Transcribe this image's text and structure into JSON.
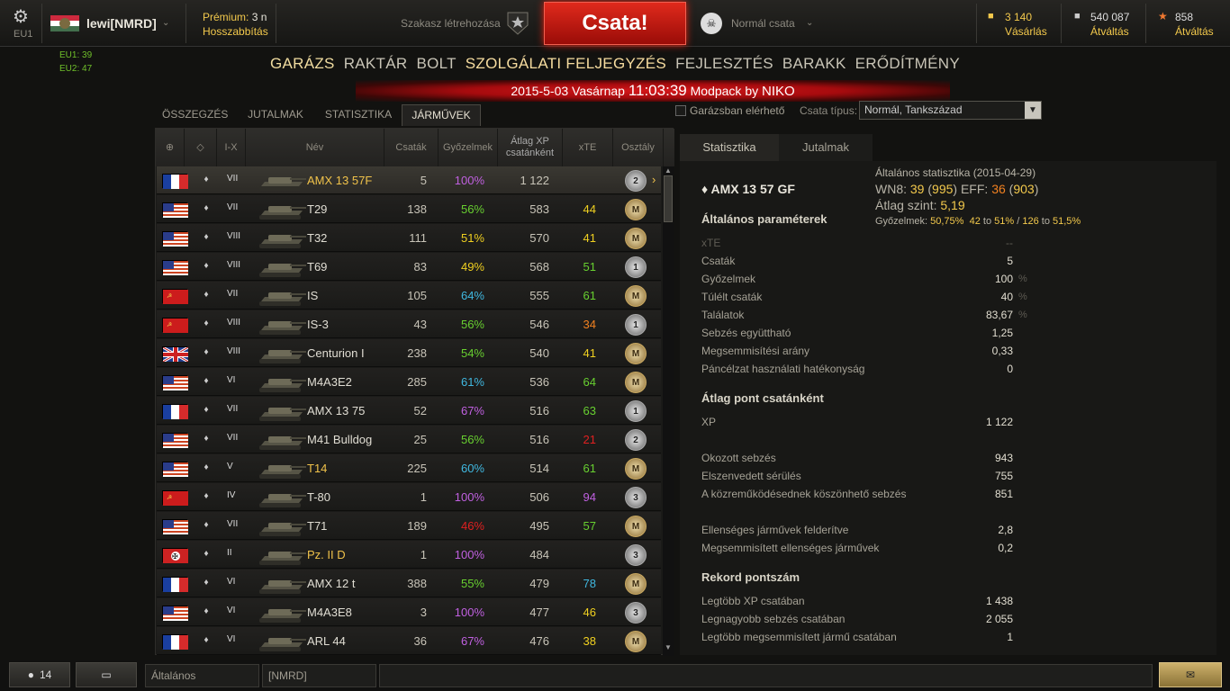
{
  "header": {
    "server": "EU1",
    "player": "lewi[NMRD]",
    "premium_label": "Prémium:",
    "premium_value": "3 n",
    "extend_label": "Hosszabbítás",
    "platoon_label": "Szakasz létrehozása",
    "battle_button": "Csata!",
    "mode_label": "Normál csata",
    "gold_value": "3 140",
    "gold_action": "Vásárlás",
    "credits_value": "540 087",
    "credits_action": "Átváltás",
    "xp_value": "858",
    "xp_action": "Átváltás",
    "online1": "EU1: 39",
    "online2": "EU2: 47"
  },
  "nav": [
    "GARÁZS",
    "RAKTÁR",
    "BOLT",
    "SZOLGÁLATI FELJEGYZÉS",
    "FEJLESZTÉS",
    "BARAKK",
    "ERŐDÍTMÉNY"
  ],
  "clock": {
    "date": "2015-5-03 Vasárnap",
    "time": "11:03:39",
    "mod": "Modpack by",
    "author": "NIKO"
  },
  "subtabs": [
    "ÖSSZEGZÉS",
    "JUTALMAK",
    "STATISZTIKA",
    "JÁRMŰVEK"
  ],
  "filter": {
    "garage_only": "Garázsban elérhető",
    "type_label": "Csata típus:",
    "type_value": "Normál, Tankszázad"
  },
  "columns": {
    "tier": "I-X",
    "name": "Név",
    "battles": "Csaták",
    "wins": "Győzelmek",
    "avgxp": "Átlag XP csatánként",
    "xte": "xTE",
    "class": "Osztály"
  },
  "rows": [
    {
      "flag": "fr",
      "tier": "VII",
      "name": "AMX 13 57F",
      "battles": "5",
      "wins": "100%",
      "wc": "#c060e0",
      "xp": "1 122",
      "xte": "",
      "xc": "#fff",
      "badge": "2",
      "gold": true,
      "sel": true
    },
    {
      "flag": "us",
      "tier": "VII",
      "name": "T29",
      "battles": "138",
      "wins": "56%",
      "wc": "#68d030",
      "xp": "583",
      "xte": "44",
      "xc": "#f0d020",
      "badge": "M"
    },
    {
      "flag": "us",
      "tier": "VIII",
      "name": "T32",
      "battles": "111",
      "wins": "51%",
      "wc": "#f0d020",
      "xp": "570",
      "xte": "41",
      "xc": "#f0d020",
      "badge": "M"
    },
    {
      "flag": "us",
      "tier": "VIII",
      "name": "T69",
      "battles": "83",
      "wins": "49%",
      "wc": "#f0d020",
      "xp": "568",
      "xte": "51",
      "xc": "#68d030",
      "badge": "1"
    },
    {
      "flag": "su",
      "tier": "VII",
      "name": "IS",
      "battles": "105",
      "wins": "64%",
      "wc": "#40b8e0",
      "xp": "555",
      "xte": "61",
      "xc": "#68d030",
      "badge": "M"
    },
    {
      "flag": "su",
      "tier": "VIII",
      "name": "IS-3",
      "battles": "43",
      "wins": "56%",
      "wc": "#68d030",
      "xp": "546",
      "xte": "34",
      "xc": "#f08020",
      "badge": "1"
    },
    {
      "flag": "uk",
      "tier": "VIII",
      "name": "Centurion I",
      "battles": "238",
      "wins": "54%",
      "wc": "#68d030",
      "xp": "540",
      "xte": "41",
      "xc": "#f0d020",
      "badge": "M"
    },
    {
      "flag": "us",
      "tier": "VI",
      "name": "M4A3E2",
      "battles": "285",
      "wins": "61%",
      "wc": "#40b8e0",
      "xp": "536",
      "xte": "64",
      "xc": "#68d030",
      "badge": "M"
    },
    {
      "flag": "fr",
      "tier": "VII",
      "name": "AMX 13 75",
      "battles": "52",
      "wins": "67%",
      "wc": "#c060e0",
      "xp": "516",
      "xte": "63",
      "xc": "#68d030",
      "badge": "1"
    },
    {
      "flag": "us",
      "tier": "VII",
      "name": "M41 Bulldog",
      "battles": "25",
      "wins": "56%",
      "wc": "#68d030",
      "xp": "516",
      "xte": "21",
      "xc": "#e02020",
      "badge": "2"
    },
    {
      "flag": "us",
      "tier": "V",
      "name": "T14",
      "battles": "225",
      "wins": "60%",
      "wc": "#40b8e0",
      "xp": "514",
      "xte": "61",
      "xc": "#68d030",
      "badge": "M",
      "gold": true
    },
    {
      "flag": "su",
      "tier": "IV",
      "name": "T-80",
      "battles": "1",
      "wins": "100%",
      "wc": "#c060e0",
      "xp": "506",
      "xte": "94",
      "xc": "#c060e0",
      "badge": "3"
    },
    {
      "flag": "us",
      "tier": "VII",
      "name": "T71",
      "battles": "189",
      "wins": "46%",
      "wc": "#e02020",
      "xp": "495",
      "xte": "57",
      "xc": "#68d030",
      "badge": "M"
    },
    {
      "flag": "de",
      "tier": "II",
      "name": "Pz. II D",
      "battles": "1",
      "wins": "100%",
      "wc": "#c060e0",
      "xp": "484",
      "xte": "",
      "xc": "#fff",
      "badge": "3",
      "gold": true
    },
    {
      "flag": "fr",
      "tier": "VI",
      "name": "AMX 12 t",
      "battles": "388",
      "wins": "55%",
      "wc": "#68d030",
      "xp": "479",
      "xte": "78",
      "xc": "#40b8e0",
      "badge": "M"
    },
    {
      "flag": "us",
      "tier": "VI",
      "name": "M4A3E8",
      "battles": "3",
      "wins": "100%",
      "wc": "#c060e0",
      "xp": "477",
      "xte": "46",
      "xc": "#f0d020",
      "badge": "3"
    },
    {
      "flag": "fr",
      "tier": "VI",
      "name": "ARL 44",
      "battles": "36",
      "wins": "67%",
      "wc": "#c060e0",
      "xp": "476",
      "xte": "38",
      "xc": "#f0d020",
      "badge": "M"
    }
  ],
  "panel": {
    "tabs": [
      "Statisztika",
      "Jutalmak"
    ],
    "vehicle": "AMX 13 57 GF",
    "gen_title": "Általános statisztika (2015-04-29)",
    "wn8_label": "WN8:",
    "wn8": "39",
    "wn8b": "995",
    "eff_label": "EFF:",
    "eff": "36",
    "effb": "903",
    "avg_label": "Átlag szint:",
    "avg": "5,19",
    "winrate_label": "Győzelmek:",
    "winrate": "50,75%",
    "wr_a": "42",
    "wr_to1": "to",
    "wr_b": "51%",
    "wr_c": "126",
    "wr_to2": "to",
    "wr_d": "51,5%",
    "sec1": "Általános paraméterek",
    "params": [
      [
        "xTE",
        "--",
        ""
      ],
      [
        "Csaták",
        "5",
        ""
      ],
      [
        "Győzelmek",
        "100",
        "%"
      ],
      [
        "Túlélt csaták",
        "40",
        "%"
      ],
      [
        "Találatok",
        "83,67",
        "%"
      ],
      [
        "Sebzés együttható",
        "1,25",
        ""
      ],
      [
        "Megsemmisítési arány",
        "0,33",
        ""
      ],
      [
        "Páncélzat használati hatékonyság",
        "0",
        ""
      ]
    ],
    "sec2": "Átlag pont csatánként",
    "avgs": [
      [
        "XP",
        "1 122"
      ],
      [
        "Okozott sebzés",
        "943"
      ],
      [
        "Elszenvedett sérülés",
        "755"
      ],
      [
        "A közreműködésednek köszönhető sebzés",
        "851"
      ],
      [
        "Ellenséges járművek felderítve",
        "2,8"
      ],
      [
        "Megsemmisített ellenséges járművek",
        "0,2"
      ]
    ],
    "sec3": "Rekord pontszám",
    "records": [
      [
        "Legtöbb XP csatában",
        "1 438"
      ],
      [
        "Legnagyobb sebzés csatában",
        "2 055"
      ],
      [
        "Legtöbb megsemmisített jármű csatában",
        "1"
      ]
    ]
  },
  "bottom": {
    "friends": "14",
    "chat1": "Általános",
    "chat2": "[NMRD]"
  }
}
